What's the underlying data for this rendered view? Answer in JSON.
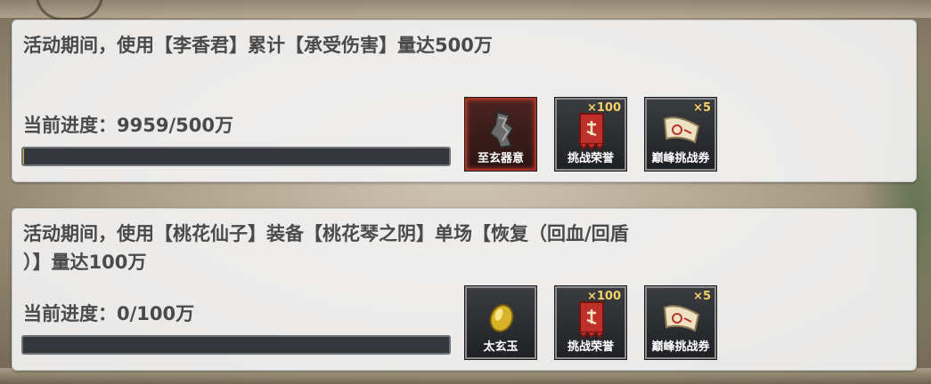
{
  "colors": {
    "card_bg": "#f1f1f2",
    "text": "#4a4a4a",
    "progress_track": "#34383d",
    "highlight_border": "#a9322a",
    "count_text": "#f5d36a"
  },
  "tasks": [
    {
      "description": "活动期间，使用【李香君】累计【承受伤害】量达500万",
      "progress_label": "当前进度：9959/500万",
      "progress_fraction": 0.002,
      "rewards": [
        {
          "name": "至玄器意",
          "count": "",
          "icon": "artifact-shard-icon",
          "highlighted": true
        },
        {
          "name": "挑战荣誉",
          "count": "×100",
          "icon": "honor-banner-icon",
          "highlighted": false
        },
        {
          "name": "巅峰挑战券",
          "count": "×5",
          "icon": "ticket-scroll-icon",
          "highlighted": false
        }
      ]
    },
    {
      "description": "活动期间，使用【桃花仙子】装备【桃花琴之阴】单场【恢复（回血/回盾\n）】量达100万",
      "progress_label": "当前进度：0/100万",
      "progress_fraction": 0,
      "rewards": [
        {
          "name": "太玄玉",
          "count": "",
          "icon": "jade-stone-icon",
          "highlighted": false
        },
        {
          "name": "挑战荣誉",
          "count": "×100",
          "icon": "honor-banner-icon",
          "highlighted": false
        },
        {
          "name": "巅峰挑战券",
          "count": "×5",
          "icon": "ticket-scroll-icon",
          "highlighted": false
        }
      ]
    }
  ]
}
